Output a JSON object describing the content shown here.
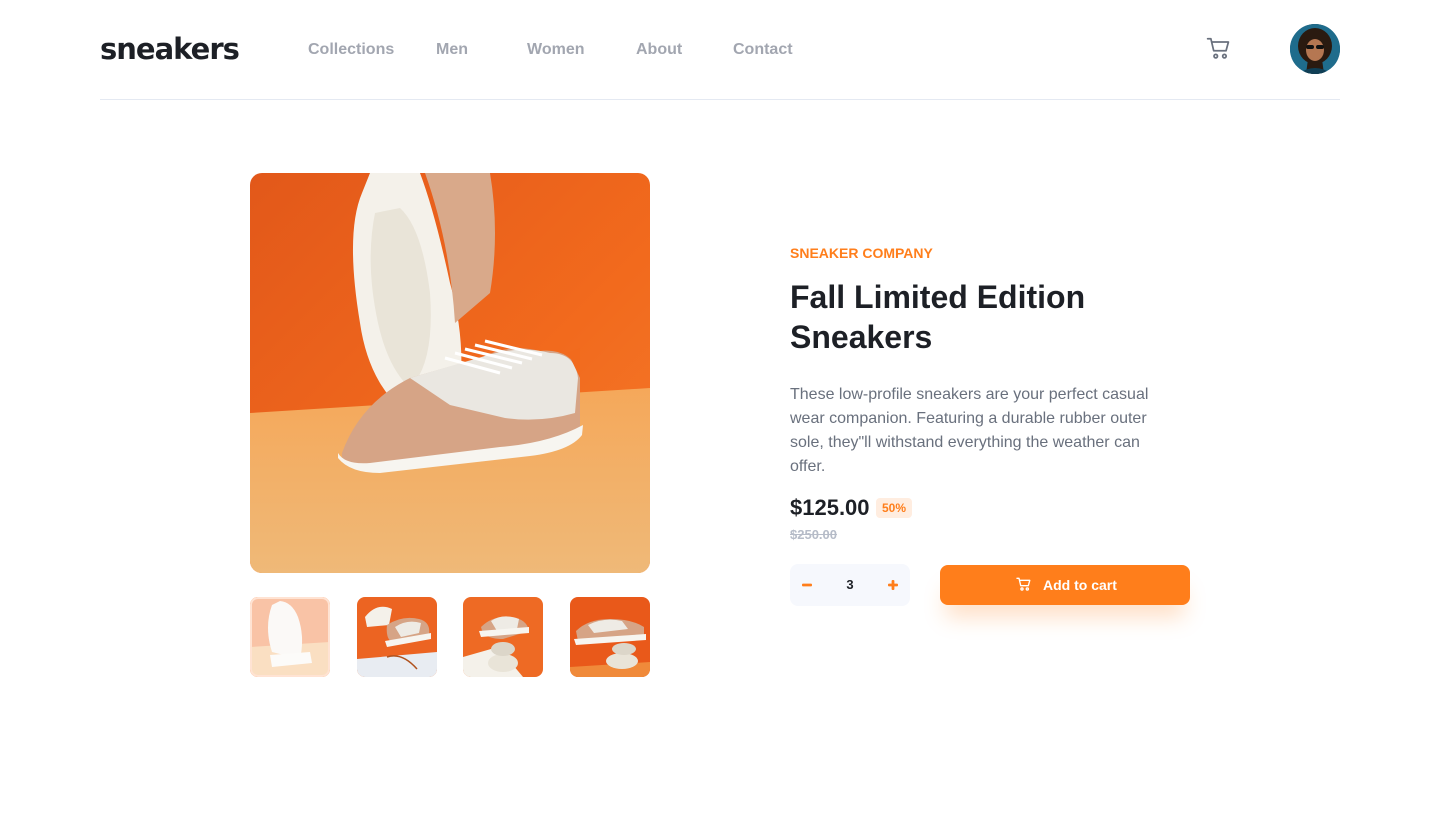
{
  "header": {
    "logo": "sneakers",
    "nav": [
      {
        "label": "Collections"
      },
      {
        "label": "Men"
      },
      {
        "label": "Women"
      },
      {
        "label": "About"
      },
      {
        "label": "Contact"
      }
    ],
    "cart_icon": "cart-icon",
    "avatar_icon": "avatar"
  },
  "gallery": {
    "thumbnails_count": 4,
    "active_thumbnail": 1
  },
  "product": {
    "company": "Sneaker Company",
    "title": "Fall Limited Edition Sneakers",
    "description": "These low-profile sneakers are your perfect casual wear companion. Featuring a durable rubber outer sole, they\"ll withstand everything the weather can offer.",
    "price": "$125.00",
    "discount": "50%",
    "original_price": "$250.00"
  },
  "cart_controls": {
    "quantity": "3",
    "add_to_cart_label": "Add to cart"
  },
  "colors": {
    "accent": "#ff7e1b",
    "accent_pale": "#ffede0",
    "text_dark": "#1d2026",
    "text_gray": "#69707d",
    "nav_gray": "#a2a6b0"
  }
}
